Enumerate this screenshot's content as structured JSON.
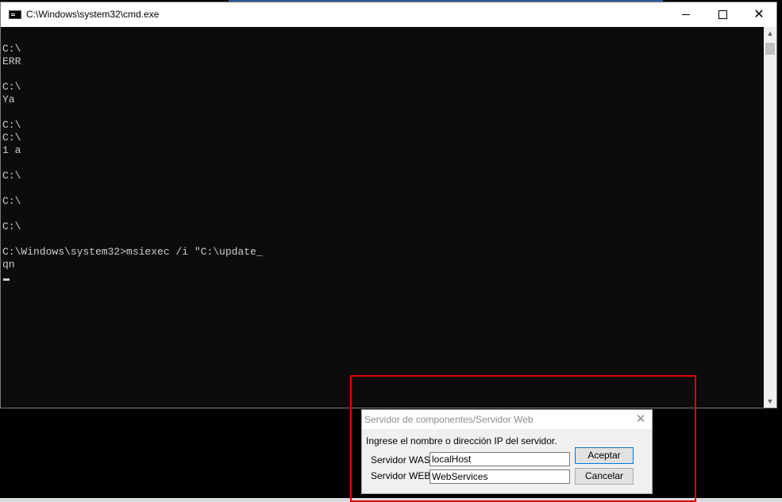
{
  "cmd": {
    "title": "C:\\Windows\\system32\\cmd.exe",
    "lines": [
      "",
      "C:\\",
      "ERR",
      "",
      "C:\\",
      "Ya",
      "",
      "C:\\",
      "C:\\",
      "1 a",
      "",
      "C:\\",
      "",
      "C:\\",
      "",
      "C:\\",
      "",
      "C:\\Windows\\system32>msiexec /i \"C:\\update_",
      "qn"
    ]
  },
  "window_controls": {
    "minimize": "minimize-icon",
    "maximize": "maximize-icon",
    "close": "close-icon"
  },
  "dialog": {
    "title": "Servidor de componentes/Servidor Web",
    "close_glyph": "✕",
    "prompt": "Ingrese el nombre o dirección IP del servidor.",
    "was_label": "Servidor WAS",
    "was_value": "localHost",
    "web_label": "Servidor WEB",
    "web_value": "WebServices",
    "ok_label": "Aceptar",
    "cancel_label": "Cancelar"
  },
  "colors": {
    "highlight": "#e00000",
    "console_bg": "#0c0c0c",
    "console_text": "#cccccc"
  }
}
